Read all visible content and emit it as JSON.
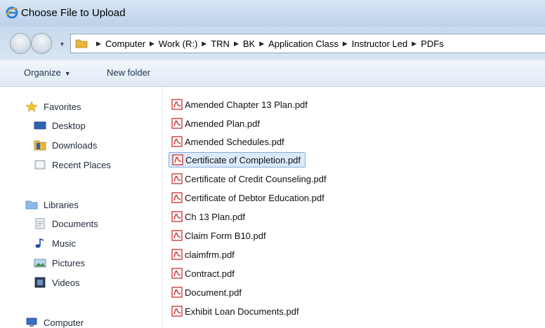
{
  "window": {
    "title": "Choose File to Upload"
  },
  "address": {
    "crumbs": [
      "Computer",
      "Work (R:)",
      "TRN",
      "BK",
      "Application Class",
      "Instructor Led",
      "PDFs"
    ]
  },
  "toolbar": {
    "organize_label": "Organize",
    "new_folder_label": "New folder"
  },
  "navpane": {
    "favorites_label": "Favorites",
    "desktop_label": "Desktop",
    "downloads_label": "Downloads",
    "recent_label": "Recent Places",
    "libraries_label": "Libraries",
    "documents_label": "Documents",
    "music_label": "Music",
    "pictures_label": "Pictures",
    "videos_label": "Videos",
    "computer_label": "Computer"
  },
  "files": [
    "Amended Chapter 13 Plan.pdf",
    "Amended Plan.pdf",
    "Amended Schedules.pdf",
    "Certificate of Completion.pdf",
    "Certificate of Credit Counseling.pdf",
    "Certificate of Debtor Education.pdf",
    "Ch 13 Plan.pdf",
    "Claim Form B10.pdf",
    "claimfrm.pdf",
    "Contract.pdf",
    "Document.pdf",
    "Exhibit Loan Documents.pdf"
  ],
  "selected_file": "Certificate of Completion.pdf",
  "colors": {
    "selection": "#dce9fb",
    "selection_border": "#84acdd",
    "pdf_red": "#c8201e"
  }
}
